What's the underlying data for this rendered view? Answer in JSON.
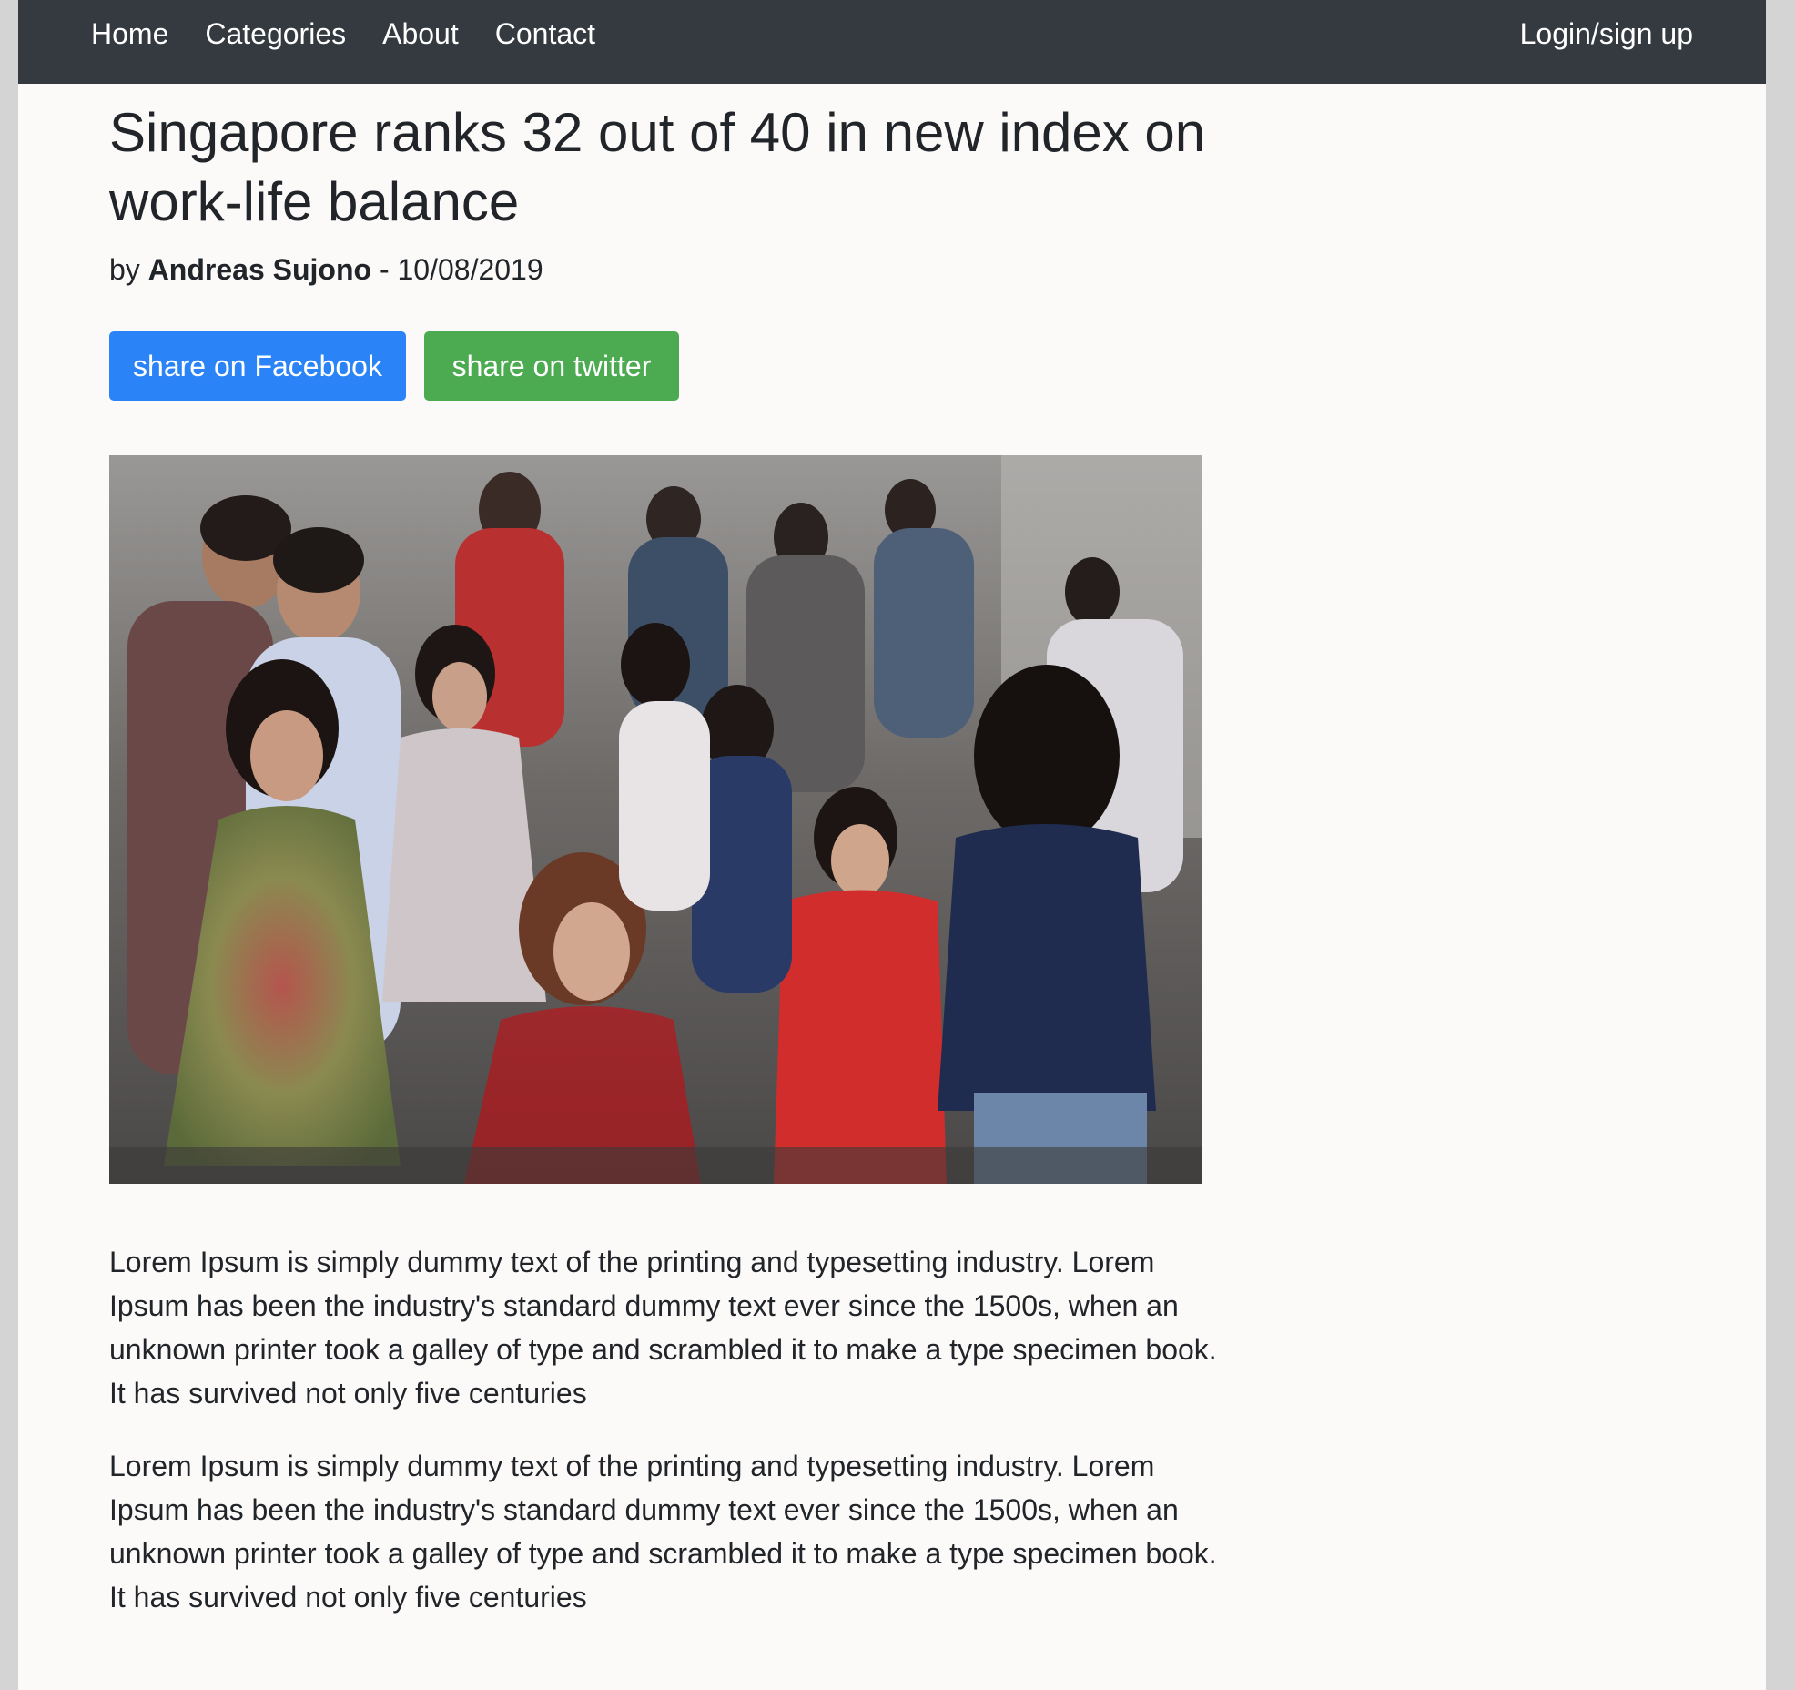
{
  "nav": {
    "items": [
      {
        "label": "Home"
      },
      {
        "label": "Categories"
      },
      {
        "label": "About"
      },
      {
        "label": "Contact"
      }
    ],
    "login_label": "Login/sign up"
  },
  "article": {
    "title": "Singapore ranks 32 out of 40 in new index on work-life balance",
    "by_prefix": "by",
    "author": "Andreas Sujono",
    "date_separator": "-",
    "date": "10/08/2019",
    "share_facebook": "share on Facebook",
    "share_twitter": "share on twitter",
    "paragraphs": [
      "Lorem Ipsum is simply dummy text of the printing and typesetting industry. Lorem Ipsum has been the industry's standard dummy text ever since the 1500s, when an unknown printer took a galley of type and scrambled it to make a type specimen book. It has survived not only five centuries",
      "Lorem Ipsum is simply dummy text of the printing and typesetting industry. Lorem Ipsum has been the industry's standard dummy text ever since the 1500s, when an unknown printer took a galley of type and scrambled it to make a type specimen book. It has survived not only five centuries"
    ]
  },
  "colors": {
    "navbar_bg": "#343a40",
    "facebook_button": "#2a84f8",
    "twitter_button": "#4caa50",
    "page_bg": "#fcfaf9"
  }
}
